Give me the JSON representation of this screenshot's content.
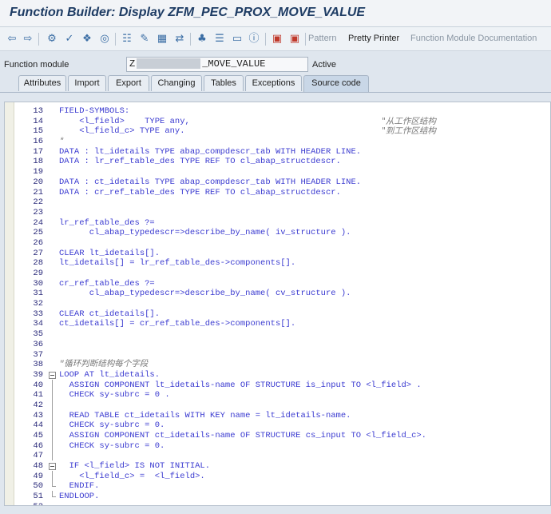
{
  "window": {
    "title": "Function Builder: Display ZFM_PEC_PROX_MOVE_VALUE"
  },
  "toolbar": {
    "icons": [
      "back-icon",
      "forward-icon",
      "other-object-icon",
      "check-icon",
      "activate-icon",
      "where-used-icon",
      "object-list-icon",
      "display-change-icon",
      "enhance-icon",
      "navigation-icon",
      "test-icon",
      "hierarchy-icon",
      "info-icon",
      "insert-icon",
      "delete-icon"
    ],
    "pattern_label": "Pattern",
    "pretty_printer_label": "Pretty Printer",
    "doc_label": "Function Module Documentation"
  },
  "function_module": {
    "label": "Function module",
    "value_prefix": "Z",
    "value_suffix": "_MOVE_VALUE",
    "status": "Active"
  },
  "tabs": [
    "Attributes",
    "Import",
    "Export",
    "Changing",
    "Tables",
    "Exceptions",
    "Source code"
  ],
  "active_tab": "Source code",
  "code": [
    {
      "n": "13",
      "t": "FIELD-SYMBOLS:",
      "c": ""
    },
    {
      "n": "14",
      "t": "    <l_field>    TYPE any,",
      "c": "\"从工作区结构"
    },
    {
      "n": "15",
      "t": "    <l_field_c> TYPE any.",
      "c": "\"到工作区结构"
    },
    {
      "n": "16",
      "t": "*",
      "c": ""
    },
    {
      "n": "17",
      "t": "DATA : lt_idetails TYPE abap_compdescr_tab WITH HEADER LINE.",
      "c": ""
    },
    {
      "n": "18",
      "t": "DATA : lr_ref_table_des TYPE REF TO cl_abap_structdescr.",
      "c": ""
    },
    {
      "n": "19",
      "t": "",
      "c": ""
    },
    {
      "n": "20",
      "t": "DATA : ct_idetails TYPE abap_compdescr_tab WITH HEADER LINE.",
      "c": ""
    },
    {
      "n": "21",
      "t": "DATA : cr_ref_table_des TYPE REF TO cl_abap_structdescr.",
      "c": ""
    },
    {
      "n": "22",
      "t": "",
      "c": ""
    },
    {
      "n": "23",
      "t": "",
      "c": ""
    },
    {
      "n": "24",
      "t": "lr_ref_table_des ?=",
      "c": ""
    },
    {
      "n": "25",
      "t": "      cl_abap_typedescr=>describe_by_name( iv_structure ).",
      "c": ""
    },
    {
      "n": "26",
      "t": "",
      "c": ""
    },
    {
      "n": "27",
      "t": "CLEAR lt_idetails[].",
      "c": ""
    },
    {
      "n": "28",
      "t": "lt_idetails[] = lr_ref_table_des->components[].",
      "c": ""
    },
    {
      "n": "29",
      "t": "",
      "c": ""
    },
    {
      "n": "30",
      "t": "cr_ref_table_des ?=",
      "c": ""
    },
    {
      "n": "31",
      "t": "      cl_abap_typedescr=>describe_by_name( cv_structure ).",
      "c": ""
    },
    {
      "n": "32",
      "t": "",
      "c": ""
    },
    {
      "n": "33",
      "t": "CLEAR ct_idetails[].",
      "c": ""
    },
    {
      "n": "34",
      "t": "ct_idetails[] = cr_ref_table_des->components[].",
      "c": ""
    },
    {
      "n": "35",
      "t": "",
      "c": ""
    },
    {
      "n": "36",
      "t": "",
      "c": ""
    },
    {
      "n": "37",
      "t": "",
      "c": ""
    },
    {
      "n": "38",
      "t": "\"循环判断结构每个字段",
      "c": "",
      "cmt": true
    },
    {
      "n": "39",
      "t": "LOOP AT lt_idetails.",
      "c": "",
      "fold": "box"
    },
    {
      "n": "40",
      "t": "  ASSIGN COMPONENT lt_idetails-name OF STRUCTURE is_input TO <l_field> .",
      "c": "",
      "fold": "vline"
    },
    {
      "n": "41",
      "t": "  CHECK sy-subrc = 0 .",
      "c": "",
      "fold": "vline"
    },
    {
      "n": "42",
      "t": "",
      "c": "",
      "fold": "vline"
    },
    {
      "n": "43",
      "t": "  READ TABLE ct_idetails WITH KEY name = lt_idetails-name.",
      "c": "",
      "fold": "vline"
    },
    {
      "n": "44",
      "t": "  CHECK sy-subrc = 0.",
      "c": "",
      "fold": "vline"
    },
    {
      "n": "45",
      "t": "  ASSIGN COMPONENT ct_idetails-name OF STRUCTURE cs_input TO <l_field_c>.",
      "c": "",
      "fold": "vline"
    },
    {
      "n": "46",
      "t": "  CHECK sy-subrc = 0.",
      "c": "",
      "fold": "vline"
    },
    {
      "n": "47",
      "t": "",
      "c": "",
      "fold": "vline"
    },
    {
      "n": "48",
      "t": "  IF <l_field> IS NOT INITIAL.",
      "c": "",
      "fold": "box"
    },
    {
      "n": "49",
      "t": "    <l_field_c> =  <l_field>.",
      "c": "",
      "fold": "vline"
    },
    {
      "n": "50",
      "t": "  ENDIF.",
      "c": "",
      "fold": "end"
    },
    {
      "n": "51",
      "t": "ENDLOOP.",
      "c": "",
      "fold": "end"
    },
    {
      "n": "52",
      "t": "",
      "c": ""
    }
  ]
}
